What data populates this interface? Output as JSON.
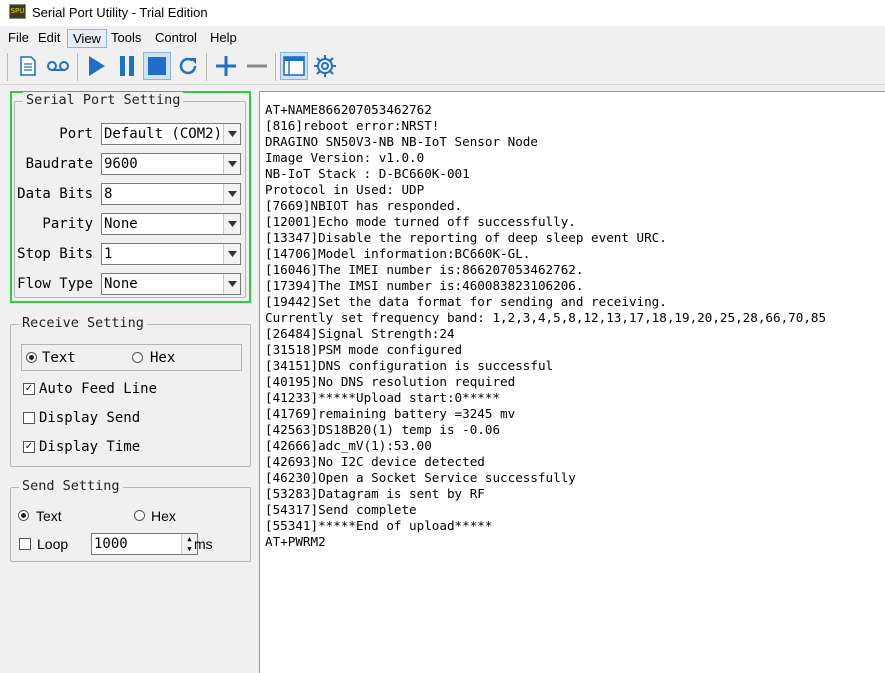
{
  "window": {
    "title": "Serial Port Utility - Trial Edition",
    "app_icon_text": "SPU"
  },
  "menu": [
    "File",
    "Edit",
    "View",
    "Tools",
    "Control",
    "Help"
  ],
  "toolbar": {
    "buttons": [
      "new-document-icon",
      "record-icon",
      "play-icon",
      "pause-icon",
      "stop-icon",
      "refresh-icon",
      "add-icon",
      "remove-icon",
      "window-icon",
      "settings-icon"
    ],
    "accent": "#1f6fc6"
  },
  "serial_port": {
    "title": "Serial Port Setting",
    "fields": [
      {
        "label": "Port",
        "value": "Default (COM2)"
      },
      {
        "label": "Baudrate",
        "value": "9600"
      },
      {
        "label": "Data Bits",
        "value": "8"
      },
      {
        "label": "Parity",
        "value": "None"
      },
      {
        "label": "Stop Bits",
        "value": "1"
      },
      {
        "label": "Flow Type",
        "value": "None"
      }
    ],
    "highlight_color": "#2ecc40"
  },
  "receive": {
    "title": "Receive Setting",
    "mode_text": "Text",
    "mode_hex": "Hex",
    "selected": "Text",
    "auto_feed_line": {
      "label": "Auto Feed Line",
      "checked": true
    },
    "display_send": {
      "label": "Display Send",
      "checked": false
    },
    "display_time": {
      "label": "Display Time",
      "checked": true
    }
  },
  "send": {
    "title": "Send Setting",
    "mode_text": "Text",
    "mode_hex": "Hex",
    "selected": "Text",
    "loop_label": "Loop",
    "loop_checked": false,
    "loop_value": "1000",
    "loop_unit": "ms"
  },
  "output": {
    "lines": [
      "AT+NAME866207053462762",
      "[816]reboot error:NRST!",
      "DRAGINO SN50V3-NB NB-IoT Sensor Node",
      "Image Version: v1.0.0",
      "NB-IoT Stack : D-BC660K-001",
      "Protocol in Used: UDP",
      "[7669]NBIOT has responded.",
      "[12001]Echo mode turned off successfully.",
      "[13347]Disable the reporting of deep sleep event URC.",
      "[14706]Model information:BC660K-GL.",
      "[16046]The IMEI number is:866207053462762.",
      "[17394]The IMSI number is:460083823106206.",
      "[19442]Set the data format for sending and receiving.",
      "Currently set frequency band: 1,2,3,4,5,8,12,13,17,18,19,20,25,28,66,70,85",
      "[26484]Signal Strength:24",
      "[31518]PSM mode configured",
      "[34151]DNS configuration is successful",
      "[40195]No DNS resolution required",
      "[41233]*****Upload start:0*****",
      "[41769]remaining battery =3245 mv",
      "[42563]DS18B20(1) temp is -0.06",
      "[42666]adc_mV(1):53.00",
      "[42693]No I2C device detected",
      "[46230]Open a Socket Service successfully",
      "[53283]Datagram is sent by RF",
      "[54317]Send complete",
      "[55341]*****End of upload*****",
      "AT+PWRM2"
    ]
  }
}
